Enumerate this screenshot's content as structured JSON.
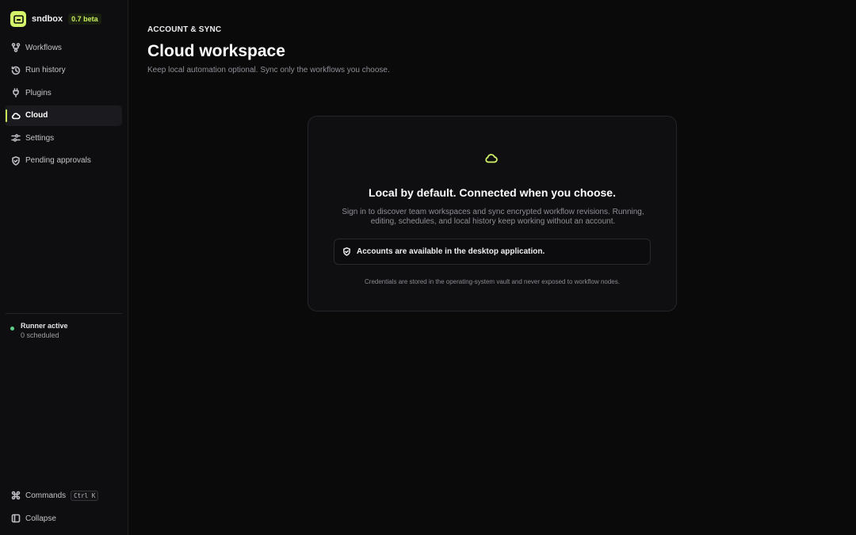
{
  "app": {
    "name": "sndbox",
    "version_badge": "0.7 beta"
  },
  "sidebar": {
    "items": [
      {
        "label": "Workflows",
        "icon": "workflow-icon",
        "active": false
      },
      {
        "label": "Run history",
        "icon": "history-icon",
        "active": false
      },
      {
        "label": "Plugins",
        "icon": "plug-icon",
        "active": false
      },
      {
        "label": "Cloud",
        "icon": "cloud-icon",
        "active": true
      },
      {
        "label": "Settings",
        "icon": "sliders-icon",
        "active": false
      },
      {
        "label": "Pending approvals",
        "icon": "shield-icon",
        "active": false
      }
    ],
    "runner": {
      "title": "Runner active",
      "subtitle": "0 scheduled"
    },
    "footer": {
      "commands_label": "Commands",
      "commands_shortcut": "Ctrl K",
      "collapse_label": "Collapse"
    }
  },
  "page": {
    "eyebrow": "ACCOUNT & SYNC",
    "title": "Cloud workspace",
    "subtitle": "Keep local automation optional. Sync only the workflows you choose."
  },
  "card": {
    "icon": "cloud-icon",
    "title": "Local by default. Connected when you choose.",
    "description": "Sign in to discover team workspaces and sync encrypted workflow revisions. Running, editing, schedules, and local history keep working without an account.",
    "notice": "Accounts are available in the desktop application.",
    "note": "Credentials are stored in the operating-system vault and never exposed to workflow nodes."
  },
  "colors": {
    "accent": "#d4f46a",
    "background": "#0a0a0b",
    "sidebar": "#0e0e10",
    "runner_status": "#5fd08a"
  }
}
